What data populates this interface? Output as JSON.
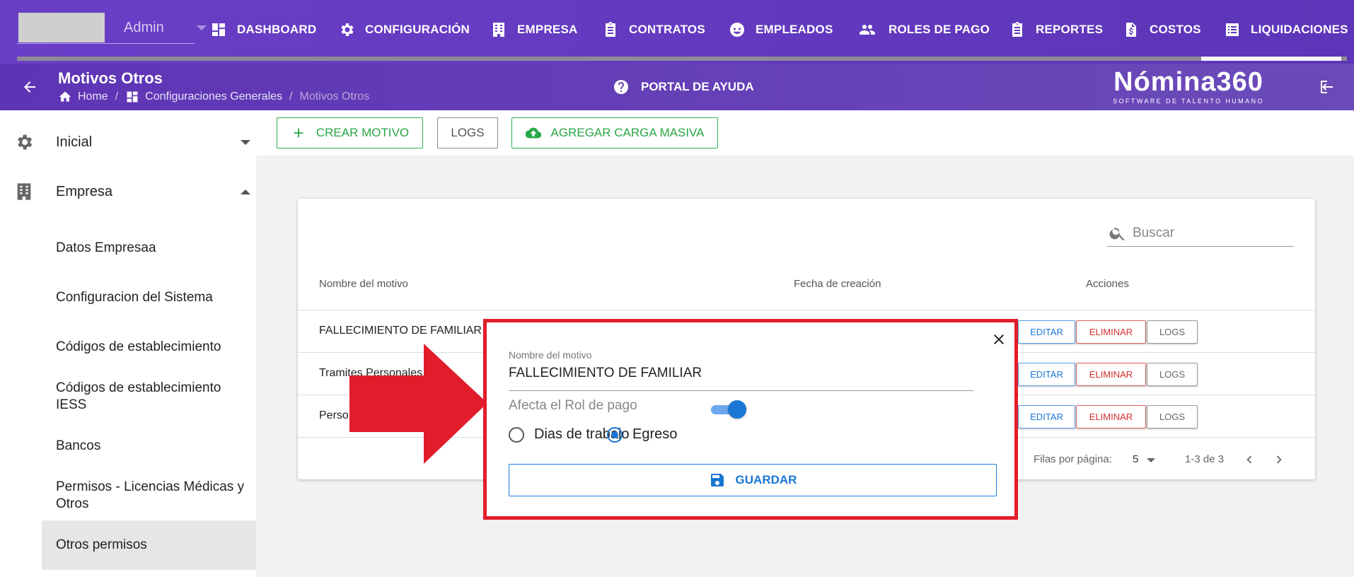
{
  "topbar": {
    "user": "Admin",
    "nav": [
      {
        "label": "DASHBOARD",
        "icon": "dashboard-icon"
      },
      {
        "label": "CONFIGURACIÓN",
        "icon": "gear-icon"
      },
      {
        "label": "EMPRESA",
        "icon": "building-icon"
      },
      {
        "label": "CONTRATOS",
        "icon": "clipboard-icon"
      },
      {
        "label": "EMPLEADOS",
        "icon": "face-icon"
      },
      {
        "label": "ROLES DE PAGO",
        "icon": "people-icon"
      },
      {
        "label": "REPORTES",
        "icon": "clipboard-icon"
      },
      {
        "label": "COSTOS",
        "icon": "invoice-dollar-icon"
      },
      {
        "label": "LIQUIDACIONES",
        "icon": "list-icon"
      }
    ]
  },
  "header": {
    "title": "Motivos Otros",
    "breadcrumb": [
      "Home",
      "Configuraciones Generales",
      "Motivos Otros"
    ],
    "help": "PORTAL DE AYUDA",
    "logo_main": "Nómina360",
    "logo_tag": "SOFTWARE DE TALENTO HUMANO"
  },
  "sidebar": {
    "sections": [
      {
        "label": "Inicial",
        "expanded": false
      },
      {
        "label": "Empresa",
        "expanded": true
      }
    ],
    "items": [
      "Datos Empresaa",
      "Configuracion del Sistema",
      "Códigos de establecimiento",
      "Códigos de establecimiento IESS",
      "Bancos",
      "Permisos - Licencias Médicas y Otros",
      "Otros permisos"
    ],
    "active": "Otros permisos"
  },
  "toolbar": {
    "create": "CREAR MOTIVO",
    "logs": "LOGS",
    "bulk": "AGREGAR CARGA MASIVA"
  },
  "table": {
    "search_placeholder": "Buscar",
    "columns": [
      "Nombre del motivo",
      "Fecha de creación",
      "Acciones"
    ],
    "rows": [
      {
        "name": "FALLECIMIENTO DE FAMILIAR"
      },
      {
        "name": "Tramites Personales"
      },
      {
        "name": "Perso"
      }
    ],
    "actions": {
      "edit": "EDITAR",
      "delete": "ELIMINAR",
      "logs": "LOGS"
    },
    "rows_per_page_label": "Filas por página:",
    "rows_per_page": "5",
    "range": "1-3 de 3"
  },
  "modal": {
    "field_label": "Nombre del motivo",
    "field_value": "FALLECIMIENTO DE FAMILIAR",
    "toggle_label": "Afecta el Rol de pago",
    "toggle_on": true,
    "radio_options": [
      "Dias de trabajo",
      "Egreso"
    ],
    "radio_selected": "Egreso",
    "save": "GUARDAR"
  },
  "colors": {
    "header_purple": "#6a3fc7",
    "accent_green": "#28a745",
    "accent_blue": "#1976d2",
    "danger_red": "#d32f2f",
    "highlight_red": "#e21d2b"
  }
}
